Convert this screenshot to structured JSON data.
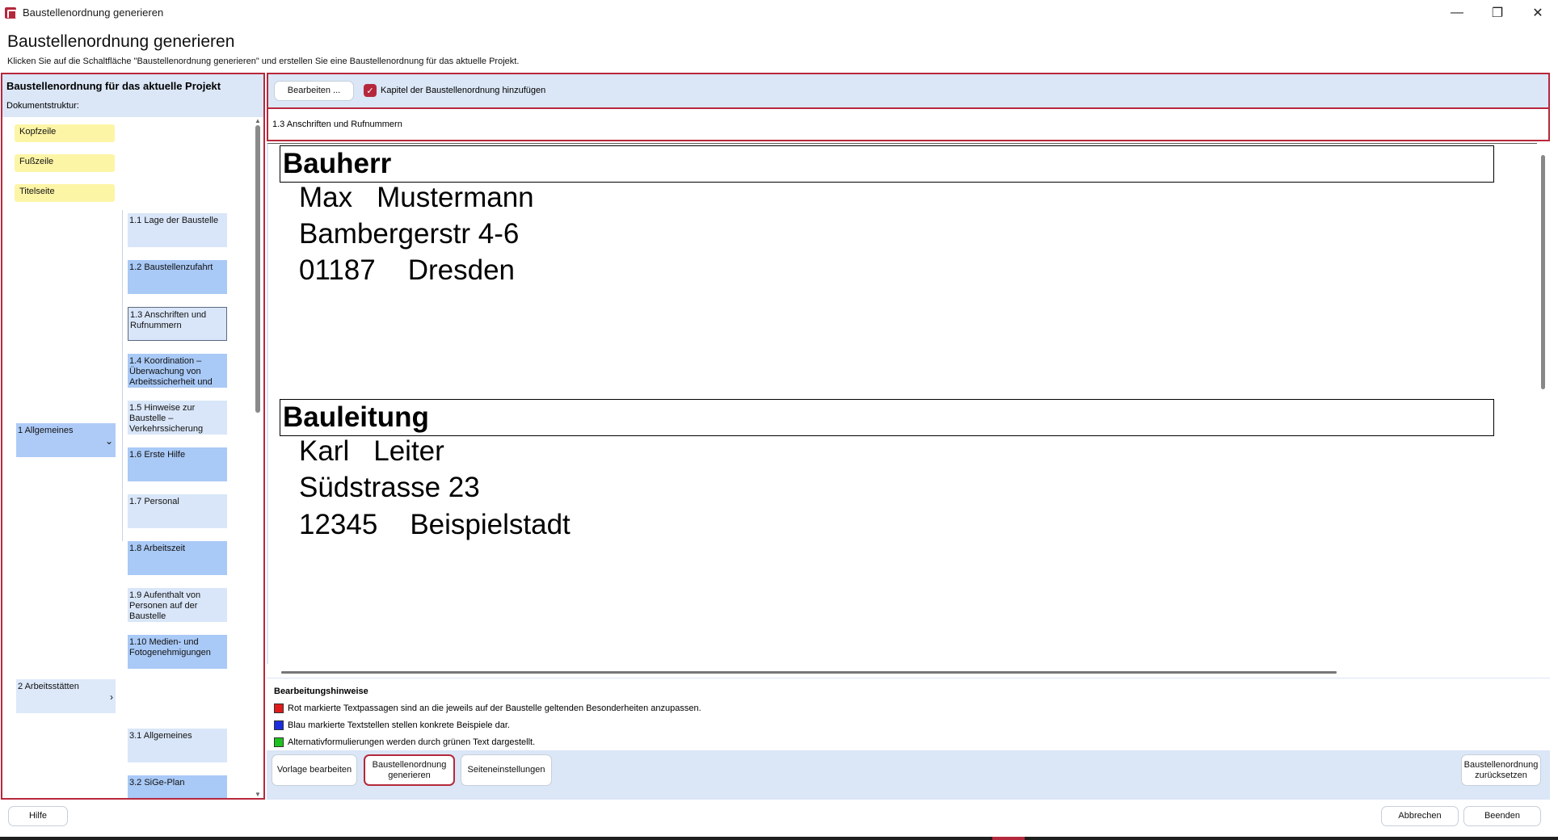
{
  "window": {
    "title": "Baustellenordnung generieren",
    "controls": {
      "minimize": "—",
      "maximize": "❐",
      "close": "✕"
    }
  },
  "header": {
    "title": "Baustellenordnung generieren",
    "subtitle": "Klicken Sie auf die Schaltfläche \"Baustellenordnung generieren\" und erstellen Sie eine Baustellenordnung für das aktuelle Projekt."
  },
  "left_panel": {
    "title": "Baustellenordnung für das aktuelle Projekt",
    "subtitle": "Dokumentstruktur:",
    "yellow_nodes": [
      "Kopfzeile",
      "Fußzeile",
      "Titelseite"
    ],
    "chapters": [
      {
        "label": "1 Allgemeines",
        "arrow": "⌄"
      },
      {
        "label": "2 Arbeitsstätten",
        "arrow": "›"
      }
    ],
    "sub_items_1": [
      "1.1 Lage der Baustelle",
      "1.2 Baustellenzufahrt",
      "1.3 Anschriften und Rufnummern",
      "1.4 Koordination – Überwachung von Arbeitssicherheit und",
      "1.5 Hinweise zur Baustelle – Verkehrssicherung",
      "1.6 Erste Hilfe",
      "1.7 Personal",
      "1.8 Arbeitszeit",
      "1.9 Aufenthalt von Personen auf der Baustelle",
      "1.10 Medien- und Fotogenehmigungen"
    ],
    "sub_items_3": [
      "3.1 Allgemeines",
      "3.2 SiGe-Plan"
    ],
    "scroll_up": "▲",
    "scroll_down": "▼"
  },
  "toolbar": {
    "edit_button": "Bearbeiten ...",
    "checkbox_label": "Kapitel der Baustellenordnung hinzufügen",
    "checkbox_mark": "✓",
    "checked": true
  },
  "chapter": {
    "current": "1.3 Anschriften und Rufnummern"
  },
  "document": {
    "sections": [
      {
        "heading": "Bauherr",
        "first_name": "Max",
        "last_name": "Mustermann",
        "street": "Bambergerstr 4-6",
        "zip": "01187",
        "city": "Dresden"
      },
      {
        "heading": "Bauleitung",
        "first_name": "Karl",
        "last_name": "Leiter",
        "street": "Südstrasse 23",
        "zip": "12345",
        "city": "Beispielstadt"
      }
    ]
  },
  "hints": {
    "title": "Bearbeitungshinweise",
    "items": [
      {
        "color": "#e11b1b",
        "text": "Rot markierte Textpassagen sind an die jeweils auf der Baustelle geltenden Besonderheiten anzupassen."
      },
      {
        "color": "#1b2de1",
        "text": "Blau markierte Textstellen stellen konkrete Beispiele dar."
      },
      {
        "color": "#1ec21e",
        "text": "Alternativformulierungen werden durch grünen Text dargestellt."
      }
    ]
  },
  "bottom_buttons": {
    "edit_template": "Vorlage bearbeiten",
    "generate": "Baustellenordnung generieren",
    "page_settings": "Seiteneinstellungen",
    "reset": "Baustellenordnung zurücksetzen"
  },
  "footer": {
    "help": "Hilfe",
    "cancel": "Abbrechen",
    "finish": "Beenden"
  },
  "colors": {
    "accent": "#b5283c",
    "panel_blue": "#dbe6f6",
    "node_blue": "#a9c9f6",
    "node_yellow": "#fdf5a6"
  }
}
